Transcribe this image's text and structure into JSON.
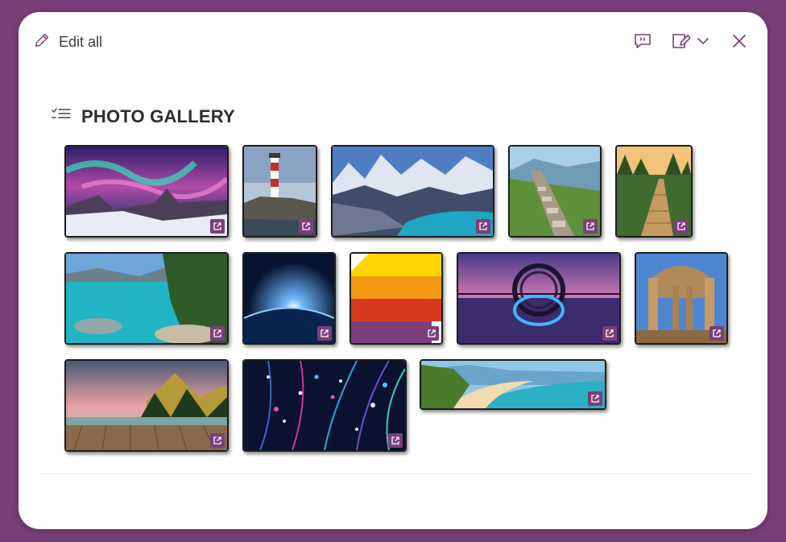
{
  "toolbar": {
    "edit_all_label": "Edit all",
    "icons": [
      "pencil-icon",
      "comment-icon",
      "edit-note-icon",
      "chevron-down-icon",
      "close-icon"
    ]
  },
  "section": {
    "title": "PHOTO GALLERY",
    "icon": "checklist-icon"
  },
  "gallery": {
    "items": [
      {
        "subject": "aurora-mountain"
      },
      {
        "subject": "lighthouse"
      },
      {
        "subject": "glacier-lake"
      },
      {
        "subject": "stone-path"
      },
      {
        "subject": "boardwalk-forest"
      },
      {
        "subject": "clear-lake"
      },
      {
        "subject": "earth-sunrise"
      },
      {
        "subject": "color-blocks"
      },
      {
        "subject": "wheel-reflection"
      },
      {
        "subject": "ancient-ruins"
      },
      {
        "subject": "mountain-sunset-dock"
      },
      {
        "subject": "fiber-optics"
      },
      {
        "subject": "beach-panorama"
      }
    ]
  },
  "colors": {
    "frame": "#7a3f78",
    "accent": "#7b3f7c",
    "card": "#ffffff"
  }
}
